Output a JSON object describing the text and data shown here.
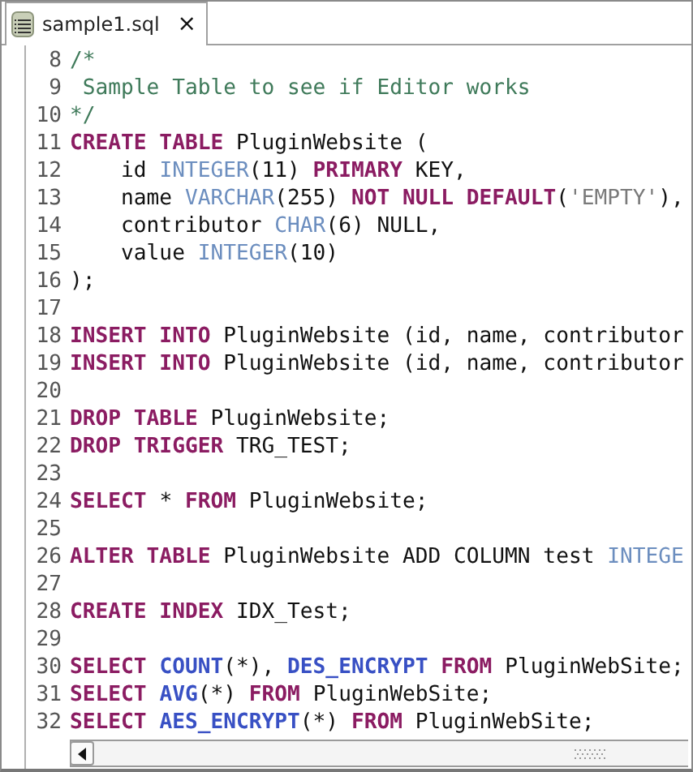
{
  "tab": {
    "title": "sample1.sql",
    "close": "×",
    "selected": true
  },
  "lines": [
    {
      "number": "8",
      "tokens": [
        {
          "kind": "comment",
          "text": "/*"
        }
      ]
    },
    {
      "number": "9",
      "tokens": [
        {
          "kind": "comment",
          "text": " Sample Table to see if Editor works"
        }
      ]
    },
    {
      "number": "10",
      "tokens": [
        {
          "kind": "comment",
          "text": "*/"
        }
      ]
    },
    {
      "number": "11",
      "tokens": [
        {
          "kind": "keyword",
          "text": "CREATE TABLE"
        },
        {
          "kind": "plain",
          "text": " PluginWebsite ("
        }
      ]
    },
    {
      "number": "12",
      "tokens": [
        {
          "kind": "plain",
          "text": "    id "
        },
        {
          "kind": "type",
          "text": "INTEGER"
        },
        {
          "kind": "plain",
          "text": "(11) "
        },
        {
          "kind": "keyword",
          "text": "PRIMARY"
        },
        {
          "kind": "plain",
          "text": " KEY,"
        }
      ]
    },
    {
      "number": "13",
      "tokens": [
        {
          "kind": "plain",
          "text": "    name "
        },
        {
          "kind": "type",
          "text": "VARCHAR"
        },
        {
          "kind": "plain",
          "text": "(255) "
        },
        {
          "kind": "keyword",
          "text": "NOT NULL DEFAULT"
        },
        {
          "kind": "plain",
          "text": "("
        },
        {
          "kind": "string",
          "text": "'EMPTY'"
        },
        {
          "kind": "plain",
          "text": "),"
        }
      ]
    },
    {
      "number": "14",
      "tokens": [
        {
          "kind": "plain",
          "text": "    contributor "
        },
        {
          "kind": "type",
          "text": "CHAR"
        },
        {
          "kind": "plain",
          "text": "(6) NULL,"
        }
      ]
    },
    {
      "number": "15",
      "tokens": [
        {
          "kind": "plain",
          "text": "    value "
        },
        {
          "kind": "type",
          "text": "INTEGER"
        },
        {
          "kind": "plain",
          "text": "(10)"
        }
      ]
    },
    {
      "number": "16",
      "tokens": [
        {
          "kind": "plain",
          "text": ");"
        }
      ]
    },
    {
      "number": "17"
    },
    {
      "number": "18",
      "tokens": [
        {
          "kind": "keyword",
          "text": "INSERT INTO"
        },
        {
          "kind": "plain",
          "text": " PluginWebsite (id, name, contributor"
        }
      ]
    },
    {
      "number": "19",
      "tokens": [
        {
          "kind": "keyword",
          "text": "INSERT INTO"
        },
        {
          "kind": "plain",
          "text": " PluginWebsite (id, name, contributor"
        }
      ]
    },
    {
      "number": "20"
    },
    {
      "number": "21",
      "tokens": [
        {
          "kind": "keyword",
          "text": "DROP TABLE"
        },
        {
          "kind": "plain",
          "text": " PluginWebsite;"
        }
      ]
    },
    {
      "number": "22",
      "tokens": [
        {
          "kind": "keyword",
          "text": "DROP TRIGGER"
        },
        {
          "kind": "plain",
          "text": " TRG_TEST;"
        }
      ]
    },
    {
      "number": "23"
    },
    {
      "number": "24",
      "tokens": [
        {
          "kind": "keyword",
          "text": "SELECT"
        },
        {
          "kind": "plain",
          "text": " * "
        },
        {
          "kind": "keyword",
          "text": "FROM"
        },
        {
          "kind": "plain",
          "text": " PluginWebsite;"
        }
      ]
    },
    {
      "number": "25"
    },
    {
      "number": "26",
      "tokens": [
        {
          "kind": "keyword",
          "text": "ALTER TABLE"
        },
        {
          "kind": "plain",
          "text": " PluginWebsite ADD COLUMN test "
        },
        {
          "kind": "type",
          "text": "INTEGE"
        }
      ]
    },
    {
      "number": "27"
    },
    {
      "number": "28",
      "tokens": [
        {
          "kind": "keyword",
          "text": "CREATE INDEX"
        },
        {
          "kind": "plain",
          "text": " IDX_Test;"
        }
      ]
    },
    {
      "number": "29"
    },
    {
      "number": "30",
      "tokens": [
        {
          "kind": "keyword",
          "text": "SELECT "
        },
        {
          "kind": "function",
          "text": "COUNT"
        },
        {
          "kind": "plain",
          "text": "(*), "
        },
        {
          "kind": "function",
          "text": "DES_ENCRYPT "
        },
        {
          "kind": "keyword",
          "text": "FROM"
        },
        {
          "kind": "plain",
          "text": " PluginWebSite;"
        }
      ]
    },
    {
      "number": "31",
      "tokens": [
        {
          "kind": "keyword",
          "text": "SELECT "
        },
        {
          "kind": "function",
          "text": "AVG"
        },
        {
          "kind": "plain",
          "text": "(*) "
        },
        {
          "kind": "keyword",
          "text": "FROM"
        },
        {
          "kind": "plain",
          "text": " PluginWebSite;"
        }
      ]
    },
    {
      "number": "32",
      "tokens": [
        {
          "kind": "keyword",
          "text": "SELECT "
        },
        {
          "kind": "function",
          "text": "AES_ENCRYPT"
        },
        {
          "kind": "plain",
          "text": "(*) "
        },
        {
          "kind": "keyword",
          "text": "FROM"
        },
        {
          "kind": "plain",
          "text": " PluginWebSite;"
        }
      ]
    }
  ]
}
